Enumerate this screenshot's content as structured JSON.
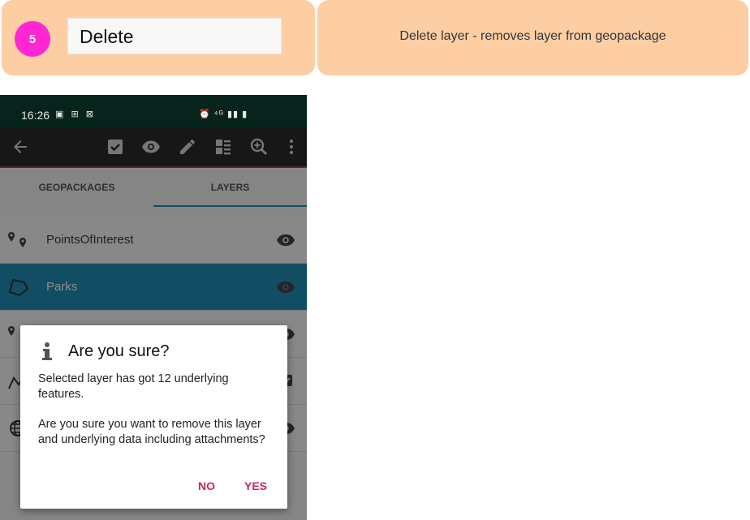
{
  "step": {
    "number": "5",
    "title": "Delete",
    "description": "Delete layer - removes layer from geopackage"
  },
  "status_bar": {
    "time": "16:26",
    "left_icons": "▣ ⊞ ⊠",
    "right_icons": "⏰ ⁴ᴳ ▮▮ ▮"
  },
  "tabs": [
    {
      "label": "GEOPACKAGES",
      "active": false
    },
    {
      "label": "LAYERS",
      "active": true
    }
  ],
  "layers": [
    {
      "label": "PointsOfInterest",
      "icon": "point-icon",
      "selected": false
    },
    {
      "label": "Parks",
      "icon": "polygon-icon",
      "selected": true
    },
    {
      "label": "",
      "icon": "point-icon",
      "selected": false
    },
    {
      "label": "",
      "icon": "line-icon",
      "selected": false
    },
    {
      "label": "",
      "icon": "globe-icon",
      "selected": false
    }
  ],
  "dialog": {
    "title": "Are you sure?",
    "message_1": "Selected layer has got 12 underlying features.",
    "message_2": "Are you sure you want to remove this layer and underlying data including attachments?",
    "no_label": "NO",
    "yes_label": "YES"
  },
  "colors": {
    "card_bg": "#fdcea4",
    "step_circle": "#ff26d4",
    "selected_row": "#1f8fb6",
    "dialog_button": "#c4266a",
    "app_bar": "#2a2a2a",
    "status_bar": "#06241c"
  }
}
